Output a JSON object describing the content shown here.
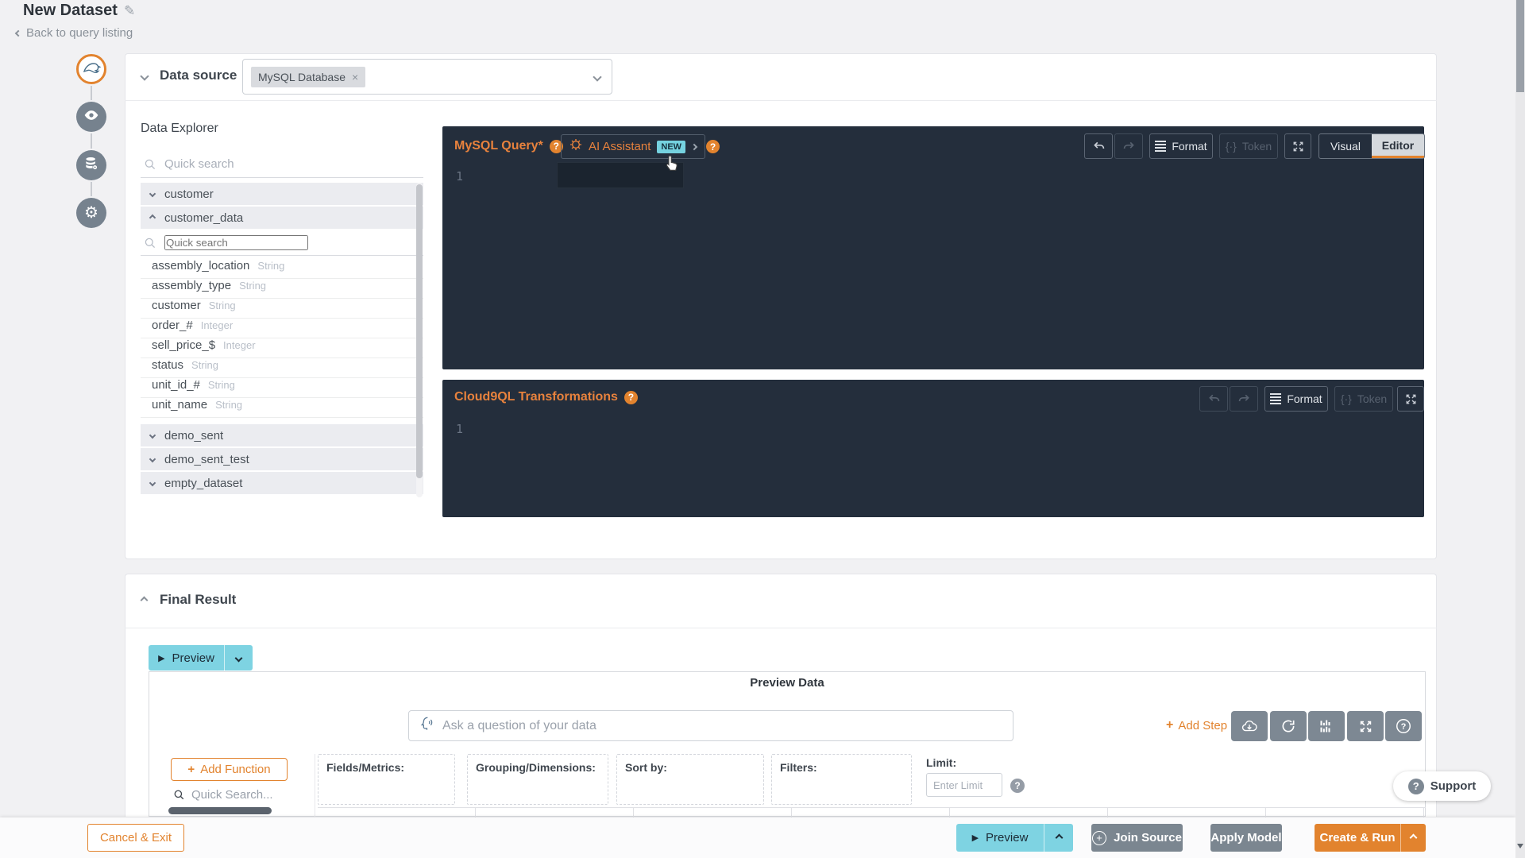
{
  "header": {
    "title": "New Dataset",
    "back_label": "Back to query listing"
  },
  "rail": {
    "steps": [
      "mysql-datasource",
      "preview",
      "dataset-settings",
      "settings"
    ]
  },
  "datasource": {
    "label": "Data source",
    "selected_tag": "MySQL Database",
    "remove_glyph": "×"
  },
  "explorer": {
    "title": "Data Explorer",
    "search_placeholder": "Quick search",
    "tables": [
      {
        "label": "customer",
        "expanded": false
      },
      {
        "label": "customer_data",
        "expanded": true,
        "search_placeholder": "Quick search",
        "fields": [
          {
            "name": "assembly_location",
            "type": "String"
          },
          {
            "name": "assembly_type",
            "type": "String"
          },
          {
            "name": "customer",
            "type": "String"
          },
          {
            "name": "order_#",
            "type": "Integer"
          },
          {
            "name": "sell_price_$",
            "type": "Integer"
          },
          {
            "name": "status",
            "type": "String"
          },
          {
            "name": "unit_id_#",
            "type": "String"
          },
          {
            "name": "unit_name",
            "type": "String"
          }
        ]
      },
      {
        "label": "demo_sent",
        "expanded": false
      },
      {
        "label": "demo_sent_test",
        "expanded": false
      },
      {
        "label": "empty_dataset",
        "expanded": false
      }
    ]
  },
  "mysql_editor": {
    "title": "MySQL Query*",
    "ai_assistant": {
      "label": "AI Assistant",
      "badge": "NEW"
    },
    "gutter_line": "1",
    "format_label": "Format",
    "token_label": "Token",
    "visual_tab": "Visual",
    "editor_tab": "Editor"
  },
  "cloud9ql_editor": {
    "title": "Cloud9QL Transformations",
    "gutter_line": "1",
    "format_label": "Format",
    "token_label": "Token"
  },
  "final_result": {
    "title": "Final Result",
    "preview_label": "Preview",
    "panel_title": "Preview Data",
    "ask_placeholder": "Ask a question of your data",
    "add_step_label": "Add Step",
    "add_function_label": "Add Function",
    "quick_search_placeholder": "Quick Search...",
    "fields_metrics_label": "Fields/Metrics:",
    "grouping_label": "Grouping/Dimensions:",
    "sort_label": "Sort by:",
    "filters_label": "Filters:",
    "limit_label": "Limit:",
    "limit_placeholder": "Enter Limit"
  },
  "footer": {
    "cancel_label": "Cancel & Exit",
    "preview_label": "Preview",
    "join_source_label": "Join Source",
    "apply_model_label": "Apply Model",
    "create_run_label": "Create & Run"
  },
  "support": {
    "label": "Support"
  },
  "icons": {
    "edit_pencil": "✎",
    "play": "▶",
    "plus": "+",
    "question": "?",
    "close": "×",
    "gear": "⚙"
  },
  "colors": {
    "accent_orange": "#e2832e",
    "cyan": "#7ed3e2",
    "editor_bg": "#242e3c",
    "gray_button": "#7b8690",
    "badge_teal": "#75d2e0"
  }
}
